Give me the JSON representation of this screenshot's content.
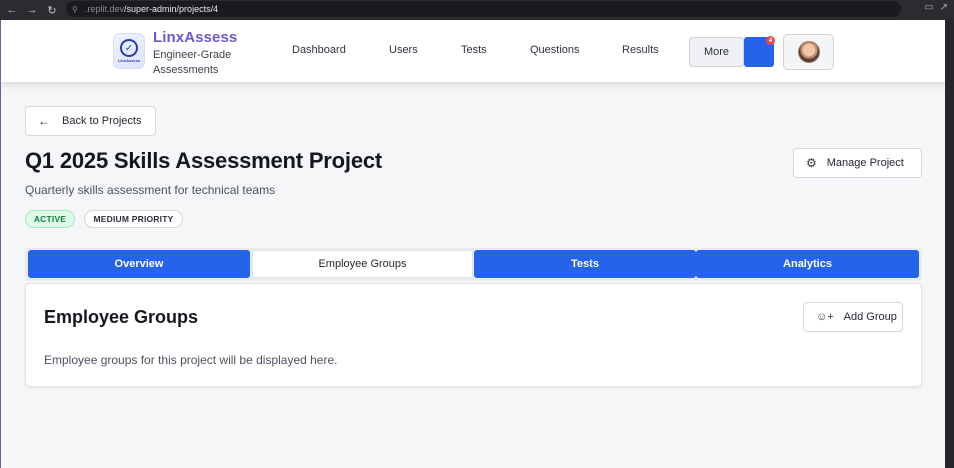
{
  "browser": {
    "url_prefix": ".replit.dev",
    "url_path": "/super-admin/projects/4",
    "icons": [
      "back-icon",
      "forward-icon",
      "reload-icon",
      "lock-icon",
      "cast-icon",
      "share-icon"
    ]
  },
  "header": {
    "brand_name": "LinxAssess",
    "brand_tag_line1": "Engineer-Grade",
    "brand_tag_line2": "Assessments",
    "logo_mini_text": "LinxAssess",
    "nav": [
      "Dashboard",
      "Users",
      "Tests",
      "Questions",
      "Results"
    ],
    "more_label": "More",
    "notification_count": "4"
  },
  "project": {
    "back_label": "Back to Projects",
    "title": "Q1 2025 Skills Assessment Project",
    "subtitle": "Quarterly skills assessment for technical teams",
    "manage_label": "Manage Project",
    "status_badge": "ACTIVE",
    "priority_badge": "MEDIUM PRIORITY"
  },
  "tabs": [
    "Overview",
    "Employee Groups",
    "Tests",
    "Analytics"
  ],
  "active_tab": "Employee Groups",
  "card": {
    "title": "Employee Groups",
    "add_label": "Add Group",
    "description": "Employee groups for this project will be displayed here."
  },
  "colors": {
    "primary": "#2563eb",
    "brand": "#6a5ad0",
    "active_green": "#15803d",
    "notification_red": "#ef4444"
  }
}
